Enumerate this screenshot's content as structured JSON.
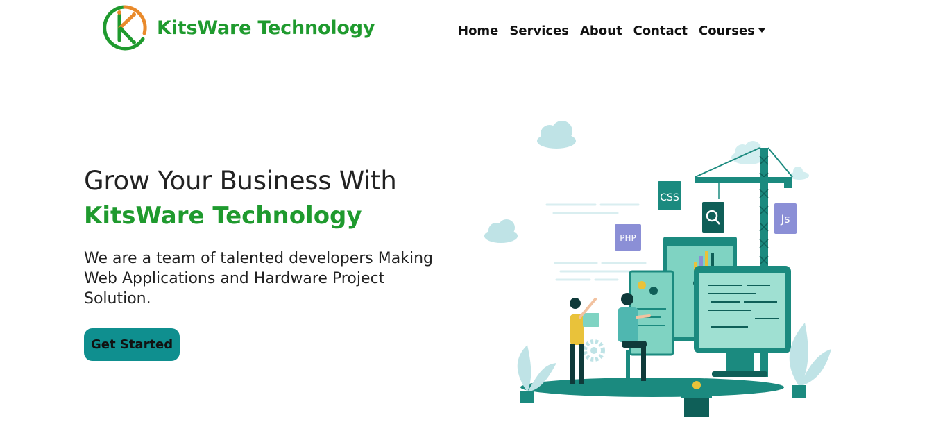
{
  "brand": {
    "name": "KitsWare Technology",
    "logo_letter": "K"
  },
  "nav": {
    "items": [
      {
        "label": "Home"
      },
      {
        "label": "Services"
      },
      {
        "label": "About"
      },
      {
        "label": "Contact"
      },
      {
        "label": "Courses"
      }
    ]
  },
  "hero": {
    "title": "Grow Your Business With",
    "brand_line": "KitsWare Technology",
    "description": "We are a team of talented developers Making Web Applications and Hardware Project Solution.",
    "cta_label": "Get Started"
  },
  "illustration": {
    "tags": {
      "css": "CSS",
      "php": "PHP",
      "js": "Js"
    }
  },
  "colors": {
    "brand_green": "#1f9a2e",
    "accent_teal": "#0f8f8f",
    "logo_orange": "#e98a2b"
  }
}
